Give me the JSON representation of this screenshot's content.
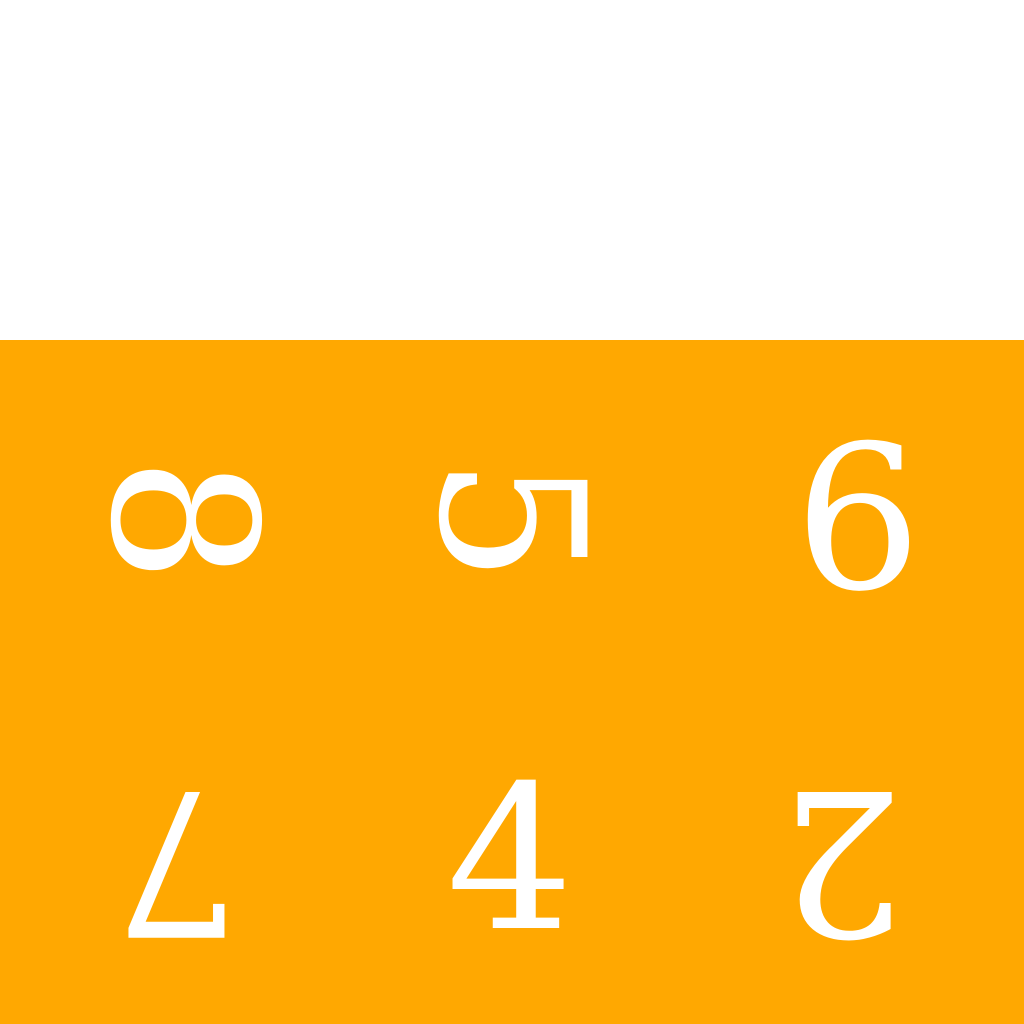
{
  "colors": {
    "board": "#FFA801",
    "top": "#FFFFFF",
    "digit": "#FFFFFF"
  },
  "tiles": [
    {
      "digit": "8",
      "orientation": "rotated-90"
    },
    {
      "digit": "5",
      "orientation": "rotated-90"
    },
    {
      "digit": "6",
      "orientation": "upright"
    },
    {
      "digit": "7",
      "orientation": "rotated-180"
    },
    {
      "digit": "4",
      "orientation": "upright"
    },
    {
      "digit": "2",
      "orientation": "rotated-180"
    }
  ]
}
